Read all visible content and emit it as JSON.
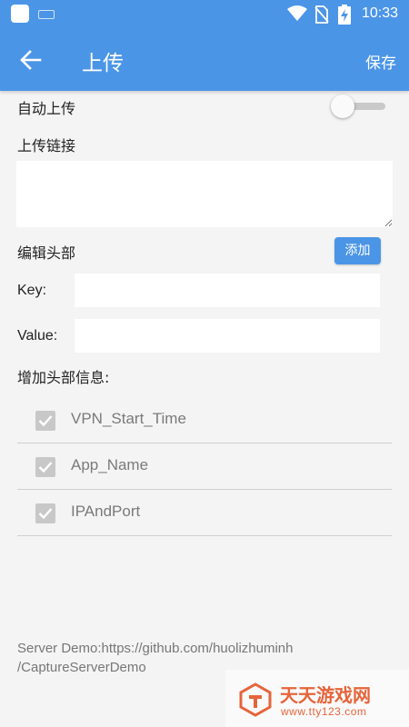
{
  "status_bar": {
    "time": "10:33"
  },
  "app_bar": {
    "title": "上传",
    "save_label": "保存"
  },
  "form": {
    "auto_upload_label": "自动上传",
    "auto_upload_on": false,
    "upload_link_label": "上传链接",
    "upload_link_value": "",
    "edit_header_label": "编辑头部",
    "add_label": "添加",
    "key_label": "Key:",
    "key_value": "",
    "value_label": "Value:",
    "value_value": "",
    "add_header_info_label": "增加头部信息:",
    "header_items": [
      {
        "label": "VPN_Start_Time",
        "checked": true
      },
      {
        "label": "App_Name",
        "checked": true
      },
      {
        "label": "IPAndPort",
        "checked": true
      }
    ]
  },
  "footer": {
    "line1": "Server Demo:https://github.com/huolizhuminh",
    "line2": "/CaptureServerDemo"
  },
  "watermark": {
    "title": "天天游戏网",
    "url": "www.tty123.com"
  },
  "colors": {
    "primary": "#4b95e7",
    "background": "#f4f4f4",
    "watermark": "#e6643a"
  }
}
